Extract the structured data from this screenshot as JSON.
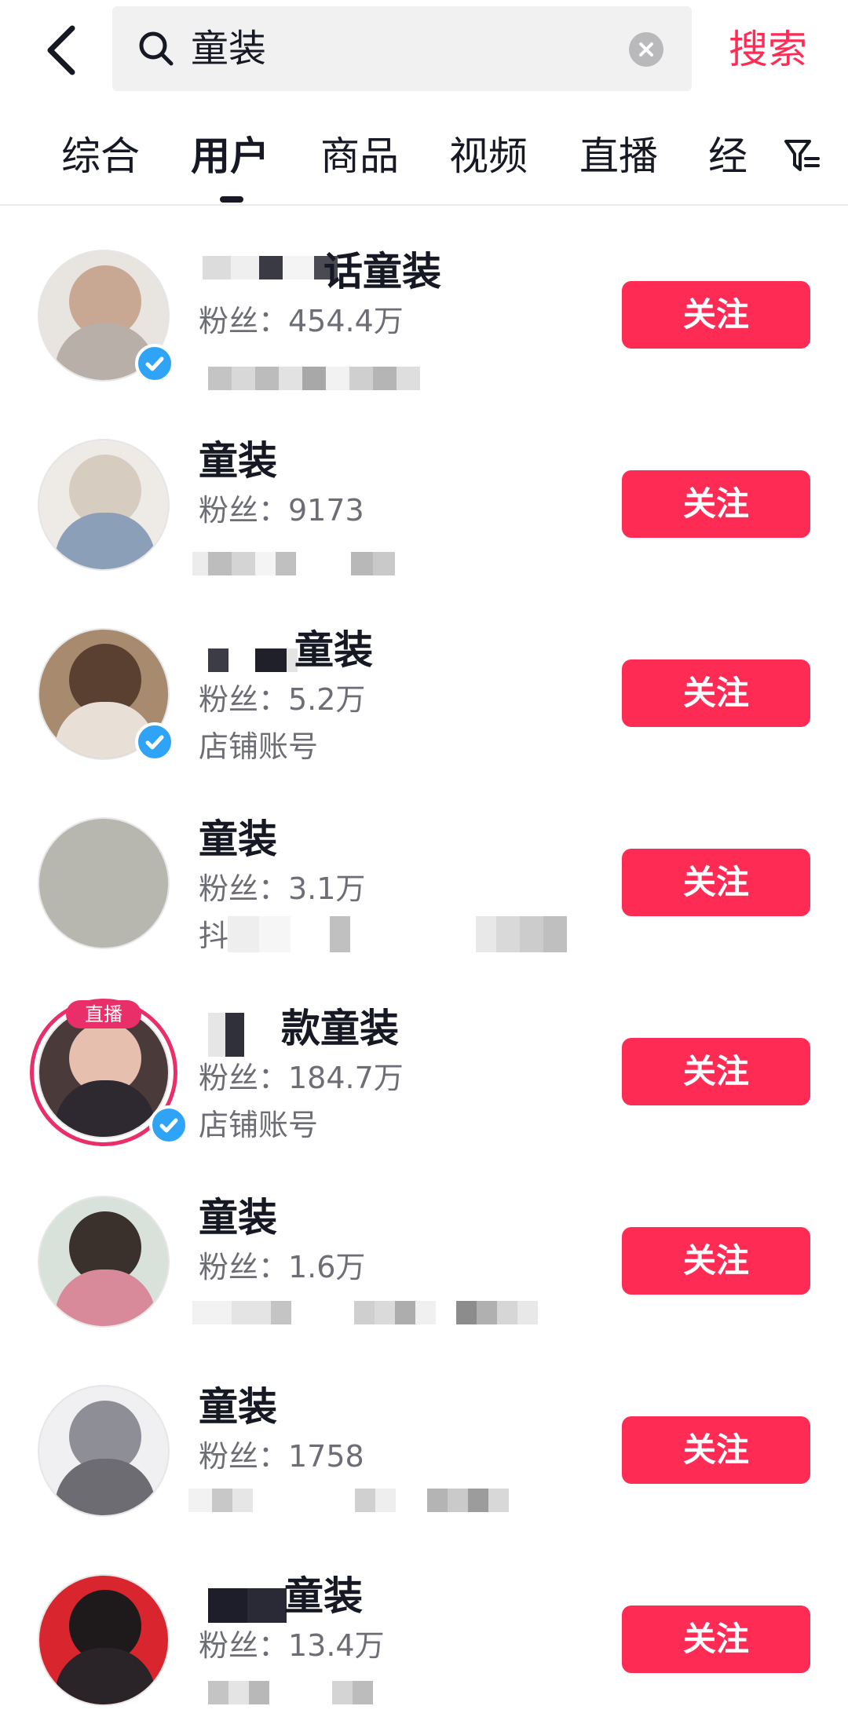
{
  "search": {
    "query": "童装",
    "button_label": "搜索"
  },
  "tabs": [
    {
      "label": "综合"
    },
    {
      "label": "用户"
    },
    {
      "label": "商品"
    },
    {
      "label": "视频"
    },
    {
      "label": "直播"
    },
    {
      "label": "经"
    }
  ],
  "active_tab": "用户",
  "users": [
    {
      "name": "话童装",
      "fans": "粉丝：454.4万",
      "desc": "",
      "verified": true,
      "live": false,
      "live_label": "",
      "follow_label": "关注"
    },
    {
      "name": "童装",
      "fans": "粉丝：9173",
      "desc": "",
      "verified": false,
      "live": false,
      "live_label": "",
      "follow_label": "关注"
    },
    {
      "name": "童装",
      "fans": "粉丝：5.2万",
      "desc": "店铺账号",
      "verified": true,
      "live": false,
      "live_label": "",
      "follow_label": "关注"
    },
    {
      "name": "童装",
      "fans": "粉丝：3.1万",
      "desc": "抖",
      "verified": false,
      "live": false,
      "live_label": "",
      "follow_label": "关注"
    },
    {
      "name": "款童装",
      "fans": "粉丝：184.7万",
      "desc": "店铺账号",
      "verified": true,
      "live": true,
      "live_label": "直播",
      "follow_label": "关注"
    },
    {
      "name": "童装",
      "fans": "粉丝：1.6万",
      "desc": "",
      "verified": false,
      "live": false,
      "live_label": "",
      "follow_label": "关注"
    },
    {
      "name": "童装",
      "fans": "粉丝：1758",
      "desc": "",
      "verified": false,
      "live": false,
      "live_label": "",
      "follow_label": "关注"
    },
    {
      "name": "童装",
      "fans": "粉丝：13.4万",
      "desc": "",
      "verified": false,
      "live": false,
      "live_label": "",
      "follow_label": "关注"
    }
  ],
  "colors": {
    "accent": "#fe2c55",
    "verified": "#2fa3f6",
    "live": "#ea2e69",
    "text_primary": "#161823",
    "text_secondary": "#6d6e75"
  },
  "icons": {
    "back": "back-arrow-icon",
    "search": "search-icon",
    "clear": "clear-icon",
    "filter": "filter-icon",
    "verified": "verified-badge-icon"
  }
}
